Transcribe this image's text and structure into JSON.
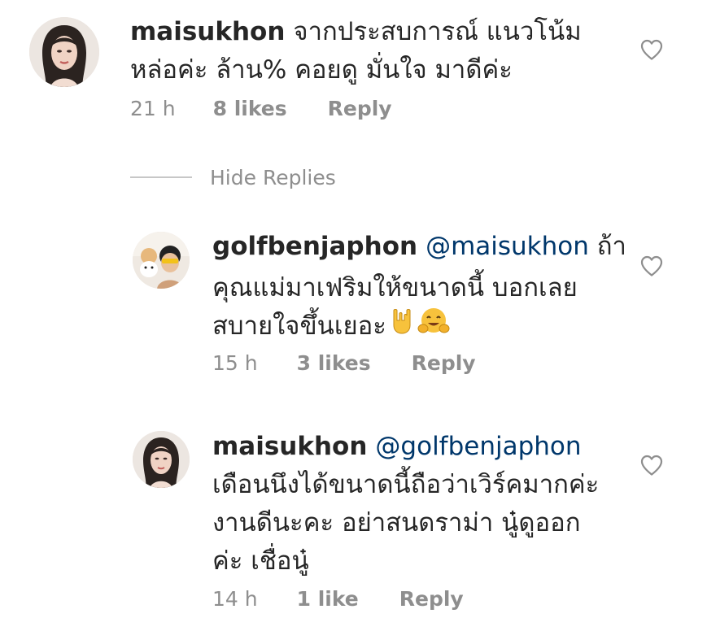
{
  "comments": [
    {
      "username": "maisukhon",
      "mention": "",
      "lines": [
        "จากประสบการณ์ แนวโน้ม",
        "หล่อค่ะ ล้าน% คอยดู มั่นใจ มาดีค่ะ"
      ],
      "time": "21 h",
      "likes": "8 likes",
      "reply": "Reply"
    },
    {
      "username": "golfbenjaphon",
      "mention": "@maisukhon",
      "lines": [
        "ถ้า",
        "คุณแม่มาเฟริมให้ขนาดนี้ บอกเลย",
        "สบายใจขึ้นเยอะ"
      ],
      "emojis": [
        "rock-on-hand-emoji",
        "hugging-face-emoji"
      ],
      "time": "15 h",
      "likes": "3 likes",
      "reply": "Reply"
    },
    {
      "username": "maisukhon",
      "mention": "@golfbenjaphon",
      "lines": [
        "",
        "เดือนนึงได้ขนาดนี้ถือว่าเวิร์คมากค่ะ",
        "งานดีนะคะ อย่าสนดราม่า นู๋ดูออก",
        "ค่ะ เชื่อนู๋"
      ],
      "time": "14 h",
      "likes": "1 like",
      "reply": "Reply"
    }
  ],
  "hide_replies": "Hide Replies",
  "icons": {
    "heart": "heart-outline-icon"
  },
  "colors": {
    "text": "#262626",
    "muted": "#8e8e8e",
    "mention": "#00376b",
    "divider": "#c7c7c7"
  }
}
